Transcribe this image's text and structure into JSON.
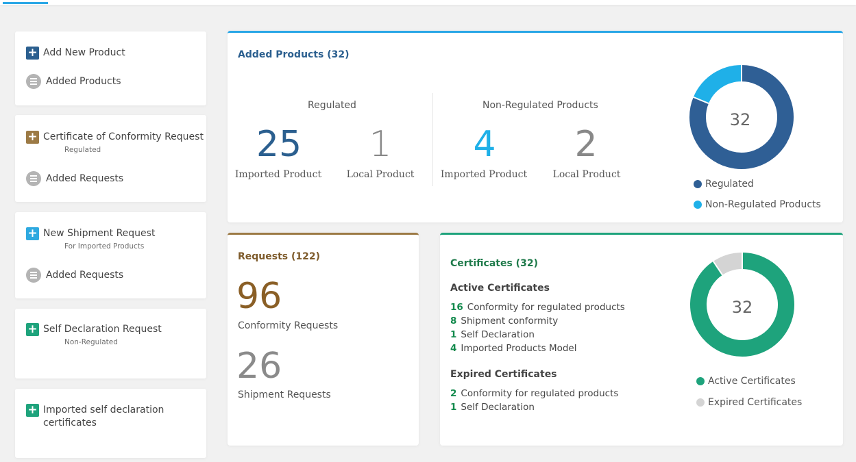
{
  "sidebar": {
    "card1": {
      "add_new_product": "Add New Product",
      "added_products": "Added Products"
    },
    "card2": {
      "coc_request": "Certificate of Conformity Request",
      "coc_sub": "Regulated",
      "added_requests": "Added Requests"
    },
    "card3": {
      "shipment_request": "New Shipment Request",
      "shipment_sub": "For Imported Products",
      "added_requests": "Added Requests"
    },
    "card4": {
      "self_declaration": "Self Declaration Request",
      "self_declaration_sub": "Non-Regulated"
    },
    "card5": {
      "imported_self_declaration_line1": "Imported self declaration",
      "imported_self_declaration_line2": "certificates"
    }
  },
  "products": {
    "title": "Added Products (32)",
    "regulated_label": "Regulated",
    "non_regulated_label": "Non-Regulated Products",
    "regulated_imported": "25",
    "regulated_local": "1",
    "non_regulated_imported": "4",
    "non_regulated_local": "2",
    "imported_label": "Imported Product",
    "local_label": "Local Product",
    "donut_total": "32",
    "legend_regulated": "Regulated",
    "legend_non_regulated": "Non-Regulated Products"
  },
  "requests": {
    "title": "Requests (122)",
    "conformity_count": "96",
    "conformity_label": "Conformity Requests",
    "shipment_count": "26",
    "shipment_label": "Shipment Requests"
  },
  "certificates": {
    "title": "Certificates (32)",
    "active_heading": "Active Certificates",
    "active_items": [
      {
        "count": "16",
        "label": "Conformity for regulated products"
      },
      {
        "count": "8",
        "label": "Shipment conformity"
      },
      {
        "count": "1",
        "label": "Self Declaration"
      },
      {
        "count": "4",
        "label": "Imported Products Model"
      }
    ],
    "expired_heading": "Expired Certificates",
    "expired_items": [
      {
        "count": "2",
        "label": "Conformity for regulated products"
      },
      {
        "count": "1",
        "label": "Self Declaration"
      }
    ],
    "donut_total": "32",
    "legend_active": "Active Certificates",
    "legend_expired": "Expired Certificates"
  },
  "chart_data": [
    {
      "type": "pie",
      "donut": true,
      "categories": [
        "Regulated",
        "Non-Regulated Products"
      ],
      "values": [
        26,
        6
      ],
      "center_label": "32"
    },
    {
      "type": "pie",
      "donut": true,
      "categories": [
        "Active Certificates",
        "Expired Certificates"
      ],
      "values": [
        29,
        3
      ],
      "center_label": "32"
    }
  ],
  "colors": {
    "primary_blue": "#2f5f95",
    "light_blue": "#1fb0e8",
    "brown": "#8a6a3a",
    "green": "#1ea37c",
    "grey": "#d4d4d4"
  }
}
